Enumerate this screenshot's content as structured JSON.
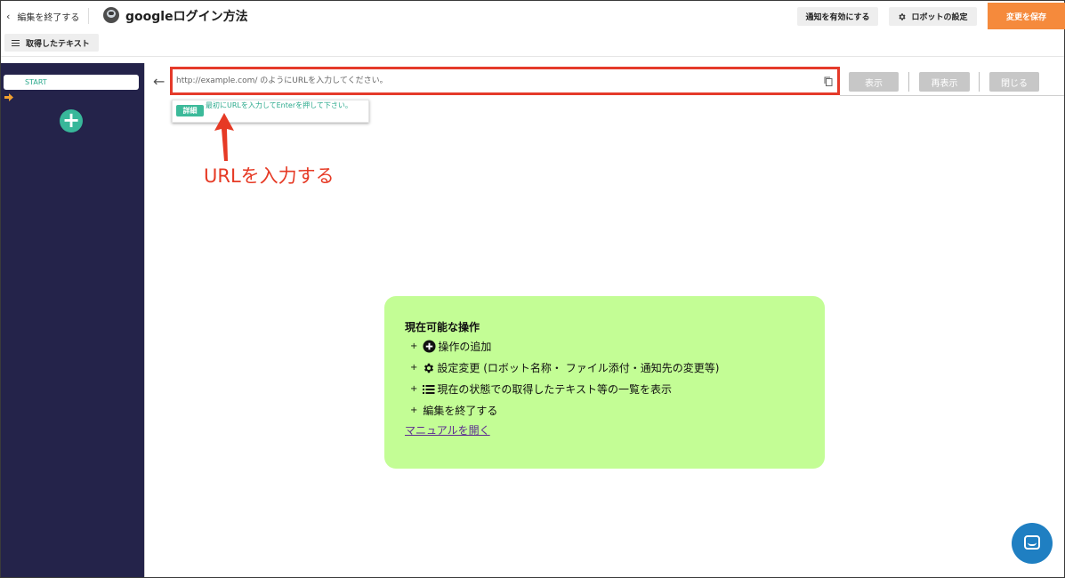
{
  "header": {
    "back_label": "編集を終了する",
    "title": "googleログイン方法",
    "notify_label": "通知を有効にする",
    "robot_settings_label": "ロボットの設定",
    "save_label": "変更を保存",
    "fetched_text_label": "取得したテキスト",
    "save_color": "#f58a3c"
  },
  "sidebar": {
    "start_label": "START",
    "add_icon": "plus-circle-icon"
  },
  "browser": {
    "url_placeholder": "http://example.com/ のようにURLを入力してください。",
    "url_value": "",
    "display_label": "表示",
    "redisplay_label": "再表示",
    "close_label": "閉じる"
  },
  "hint": {
    "badge": "詳細",
    "text": "最初にURLを入力してEnterを押して下さい。"
  },
  "annotation": {
    "text": "URLを入力する",
    "color": "#e63a25"
  },
  "help": {
    "title": "現在可能な操作",
    "items": [
      {
        "prefix": "+",
        "icon": "plus-circle-icon",
        "label": "操作の追加"
      },
      {
        "prefix": "+",
        "icon": "gear-icon",
        "label": "設定変更 (ロボット名称・ ファイル添付・通知先の変更等)"
      },
      {
        "prefix": "+",
        "icon": "list-icon",
        "label": "現在の状態での取得したテキスト等の一覧を表示"
      },
      {
        "prefix": "+",
        "icon": "",
        "label": "編集を終了する"
      }
    ],
    "manual_link": "マニュアルを開く",
    "background": "#c3fd95"
  },
  "chat": {
    "icon": "chat-icon",
    "color": "#1f7fc2"
  }
}
